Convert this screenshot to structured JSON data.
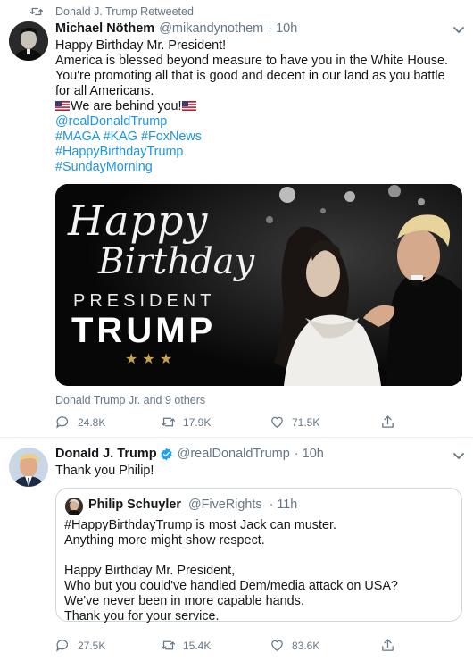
{
  "tweet1": {
    "retweet_label": "Donald J. Trump Retweeted",
    "name": "Michael Nöthem",
    "handle": "@mikandynothem",
    "time": "· 10h",
    "lines": [
      "Happy Birthday Mr. President!",
      "America is blessed beyond measure to have you in the White House.",
      "You're promoting all that is good and decent in our land as you battle",
      "for all Americans."
    ],
    "behind": "We are behind you!",
    "mention": "@realDonaldTrump",
    "hashtags1": "#MAGA #KAG #FoxNews",
    "hashtags2": "#HappyBirthdayTrump",
    "hashtags3": "#SundayMorning",
    "media": {
      "happy": "Happy",
      "birthday": "Birthday",
      "president": "PRESIDENT",
      "trump": "TRUMP",
      "stars": "★ ★ ★"
    },
    "tagged": "Donald Trump Jr. and 9 others",
    "replies": "24.8K",
    "retweets": "17.9K",
    "likes": "71.5K"
  },
  "tweet2": {
    "name": "Donald J. Trump",
    "handle": "@realDonaldTrump",
    "time": "· 10h",
    "text": "Thank you Philip!",
    "quote": {
      "name": "Philip Schuyler",
      "handle": "@FiveRights",
      "time": "· 11h",
      "lines": [
        "#HappyBirthdayTrump is most Jack can muster.",
        "Anything more might show respect.",
        "",
        "Happy Birthday Mr. President,",
        "Who but you could've handled Dem/media attack on USA?",
        "We've never been in more capable hands.",
        "Thank you for your service."
      ]
    },
    "replies": "27.5K",
    "retweets": "15.4K",
    "likes": "83.6K"
  },
  "colors": {
    "link": "#1b95e0",
    "secondary": "#657786",
    "verified": "#1da1f2"
  },
  "icons": [
    "retweet-icon",
    "caret-down-icon",
    "reply-icon",
    "retweet-icon",
    "like-icon",
    "share-icon",
    "verified-icon",
    "us-flag-icon"
  ]
}
